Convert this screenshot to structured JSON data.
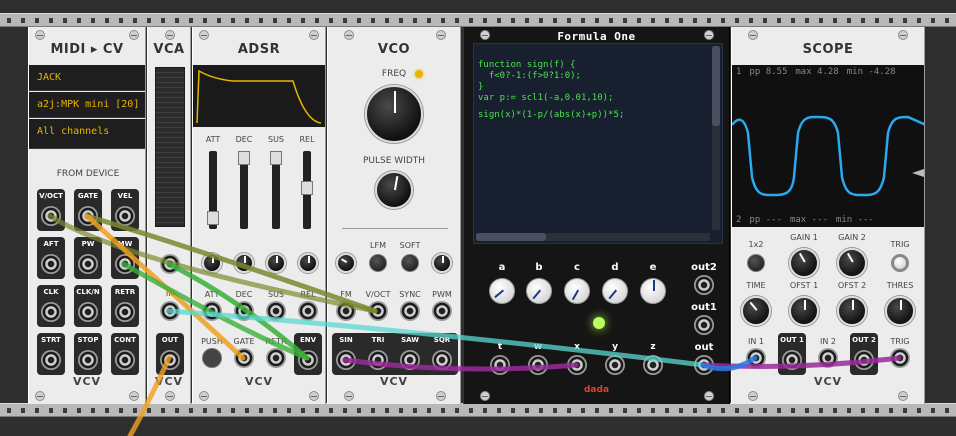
{
  "midi_cv": {
    "title": "MIDI ▸ CV",
    "driver": "JACK",
    "device": "a2j:MPK mini [20] (",
    "channel": "All channels",
    "section": "FROM DEVICE",
    "ports": [
      "V/OCT",
      "GATE",
      "VEL",
      "AFT",
      "PW",
      "MW",
      "CLK",
      "CLK/N",
      "RETR",
      "STRT",
      "STOP",
      "CONT"
    ],
    "brand": "VCV"
  },
  "vca": {
    "title": "VCA",
    "in": "IN",
    "out": "OUT",
    "brand": "VCV"
  },
  "adsr": {
    "title": "ADSR",
    "sliders": [
      "ATT",
      "DEC",
      "SUS",
      "REL"
    ],
    "inputs": [
      "ATT",
      "DEC",
      "SUS",
      "REL"
    ],
    "push": "PUSH",
    "gate": "GATE",
    "retr": "RETR",
    "env": "ENV",
    "brand": "VCV"
  },
  "vco": {
    "title": "VCO",
    "freq": "FREQ",
    "pulse_width": "PULSE WIDTH",
    "lfm": "LFM",
    "soft": "SOFT",
    "inputs": [
      "FM",
      "V/OCT",
      "SYNC",
      "PWM"
    ],
    "outputs": [
      "SIN",
      "TRI",
      "SAW",
      "SQR"
    ],
    "brand": "VCV"
  },
  "formula": {
    "title": "Formula One",
    "code": [
      "function sign(f) {",
      "  f<0?-1:(f>0?1:0);",
      "}",
      "var p:= scl1(-a,0.01,10);",
      "",
      "sign(x)*(1-p/(abs(x)+p))*5;"
    ],
    "knobs": [
      "a",
      "b",
      "c",
      "d",
      "e"
    ],
    "ports": [
      "t",
      "w",
      "x",
      "y",
      "z"
    ],
    "out2": "out2",
    "out1": "out1",
    "out": "out",
    "brand": "dada"
  },
  "scope": {
    "title": "SCOPE",
    "ch1": {
      "index": "1",
      "pp_label": "pp",
      "pp": "8.55",
      "max_label": "max",
      "max": "4.28",
      "min_label": "min",
      "min": "-4.28"
    },
    "ch2": {
      "index": "2",
      "pp_label": "pp",
      "pp": "---",
      "max_label": "max",
      "max": "---",
      "min_label": "min",
      "min": "---"
    },
    "controls_row1": [
      "1x2",
      "GAIN 1",
      "GAIN 2",
      "TRIG"
    ],
    "controls_row2": [
      "TIME",
      "OFST 1",
      "OFST 2",
      "THRES"
    ],
    "ports": [
      "IN 1",
      "OUT 1",
      "IN 2",
      "OUT 2",
      "TRIG"
    ],
    "brand": "VCV"
  },
  "colors": {
    "cable_orange": "#f0a020",
    "cable_green": "#3ab03a",
    "cable_cyan": "#5ad8d0",
    "cable_purple": "#9a2a9a",
    "cable_blue": "#2a7ae8",
    "cable_olive": "#7a8a30",
    "scope_trace": "#2aa8f0",
    "code_green": "#4ee04e"
  }
}
